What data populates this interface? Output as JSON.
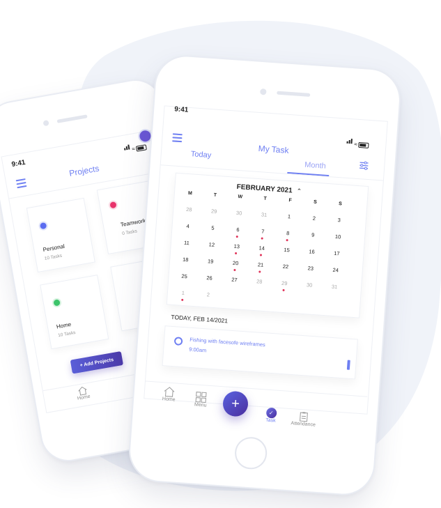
{
  "theme": {
    "accent": "#6e7ff2",
    "accent_dark": "#4a2e9e",
    "event_dot": "#e0345a",
    "blob": "#f0f3f9"
  },
  "back_phone": {
    "time": "9:41",
    "title": "Projects",
    "projects": [
      {
        "name": "Personal",
        "tasks": "10 Tasks",
        "color": "#5b6cf0"
      },
      {
        "name": "Teamworks",
        "tasks": "0 Tasks",
        "color": "#e8336b"
      },
      {
        "name": "Home",
        "tasks": "10 Tasks",
        "color": "#3cc46a"
      }
    ],
    "add_button": "+ Add Projects",
    "nav": {
      "home": "Home"
    }
  },
  "front_phone": {
    "time": "9:41",
    "title": "My Task",
    "tabs": {
      "today": "Today",
      "month": "Month"
    },
    "calendar": {
      "month_label": "FEBRUARY 2021",
      "weekdays": [
        "M",
        "T",
        "W",
        "T",
        "F",
        "S",
        "S"
      ],
      "weeks": [
        [
          "28",
          "29",
          "30",
          "31",
          "1",
          "2",
          "3"
        ],
        [
          "4",
          "5",
          "6",
          "7",
          "8",
          "9",
          "10"
        ],
        [
          "11",
          "12",
          "13",
          "14",
          "15",
          "16",
          "17"
        ],
        [
          "18",
          "19",
          "20",
          "21",
          "22",
          "23",
          "24"
        ],
        [
          "25",
          "26",
          "27",
          "28",
          "29",
          "30",
          "31"
        ],
        [
          "1",
          "2",
          "",
          "",
          "",
          "",
          ""
        ]
      ]
    },
    "today_label": "TODAY, FEB 14/2021",
    "task": {
      "title": "Fishing with facesofe wireframes",
      "time": "9:00am"
    },
    "nav": {
      "home": "Home",
      "menu": "Menu",
      "task": "Task",
      "attendance": "Attendance"
    }
  }
}
